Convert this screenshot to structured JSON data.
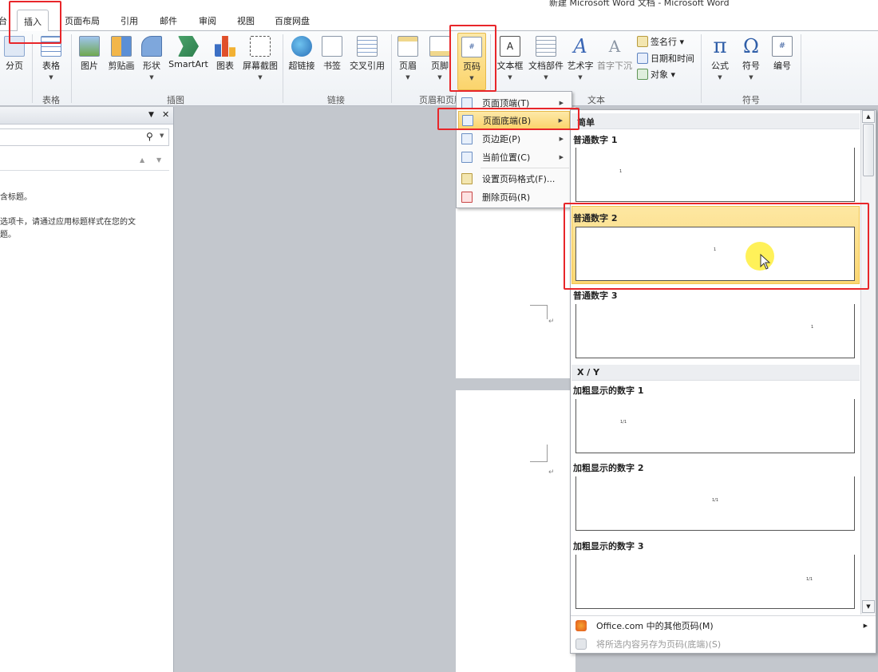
{
  "window": {
    "title": "新建 Microsoft Word 文档 - Microsoft Word"
  },
  "tabs": [
    {
      "label": "台"
    },
    {
      "label": "插入"
    },
    {
      "label": "页面布局"
    },
    {
      "label": "引用"
    },
    {
      "label": "邮件"
    },
    {
      "label": "审阅"
    },
    {
      "label": "视图"
    },
    {
      "label": "百度网盘"
    }
  ],
  "ribbon": {
    "buttons": [
      {
        "label": "分页",
        "icon": "page-break-icon"
      },
      {
        "label": "表格",
        "icon": "table-icon"
      },
      {
        "label": "图片",
        "icon": "picture-icon"
      },
      {
        "label": "剪贴画",
        "icon": "clipart-icon"
      },
      {
        "label": "形状",
        "icon": "shapes-icon"
      },
      {
        "label": "SmartArt",
        "icon": "smartart-icon"
      },
      {
        "label": "图表",
        "icon": "chart-icon"
      },
      {
        "label": "屏幕截图",
        "icon": "screenshot-icon"
      },
      {
        "label": "超链接",
        "icon": "hyperlink-icon"
      },
      {
        "label": "书签",
        "icon": "bookmark-icon"
      },
      {
        "label": "交叉引用",
        "icon": "cross-reference-icon"
      },
      {
        "label": "页眉",
        "icon": "header-icon"
      },
      {
        "label": "页脚",
        "icon": "footer-icon"
      },
      {
        "label": "页码",
        "icon": "page-number-icon"
      },
      {
        "label": "文本框",
        "icon": "textbox-icon"
      },
      {
        "label": "文档部件",
        "icon": "quick-parts-icon"
      },
      {
        "label": "艺术字",
        "icon": "wordart-icon"
      },
      {
        "label": "首字下沉",
        "icon": "dropcap-icon"
      },
      {
        "label": "公式",
        "icon": "equation-icon"
      },
      {
        "label": "符号",
        "icon": "symbol-icon"
      },
      {
        "label": "编号",
        "icon": "number-icon"
      }
    ],
    "small_items": [
      {
        "label": "签名行 ▾",
        "icon": "signature-line-icon"
      },
      {
        "label": "日期和时间",
        "icon": "date-time-icon"
      },
      {
        "label": "对象 ▾",
        "icon": "object-icon"
      }
    ],
    "groups": [
      {
        "label": "表格"
      },
      {
        "label": "插图"
      },
      {
        "label": "链接"
      },
      {
        "label": "页眉和页脚"
      },
      {
        "label": "文本"
      },
      {
        "label": "符号"
      }
    ]
  },
  "navpane": {
    "line1": "含标题。",
    "line2": "选项卡，请通过应用标题样式在您的文",
    "line3": "题。"
  },
  "menu": {
    "items": [
      {
        "label": "页面顶端(T)"
      },
      {
        "label": "页面底端(B)"
      },
      {
        "label": "页边距(P)"
      },
      {
        "label": "当前位置(C)"
      },
      {
        "label": "设置页码格式(F)..."
      },
      {
        "label": "删除页码(R)"
      }
    ]
  },
  "gallery": {
    "sections": [
      {
        "label": "简单"
      },
      {
        "label": "X / Y"
      }
    ],
    "items": [
      {
        "label": "普通数字 1",
        "preview": "1"
      },
      {
        "label": "普通数字 2",
        "preview": "1"
      },
      {
        "label": "普通数字 3",
        "preview": "1"
      },
      {
        "label": "加粗显示的数字 1",
        "preview": "1/1"
      },
      {
        "label": "加粗显示的数字 2",
        "preview": "1/1"
      },
      {
        "label": "加粗显示的数字 3",
        "preview": "1/1"
      }
    ],
    "footer": [
      {
        "label": "Office.com 中的其他页码(M)"
      },
      {
        "label": "将所选内容另存为页码(底端)(S)"
      }
    ]
  },
  "doc": {
    "para_mark": "↵"
  },
  "colors": {
    "highlight": "#fbd46c",
    "annotation": "#e8262a",
    "ribbon_bg": "#eef1f5"
  }
}
